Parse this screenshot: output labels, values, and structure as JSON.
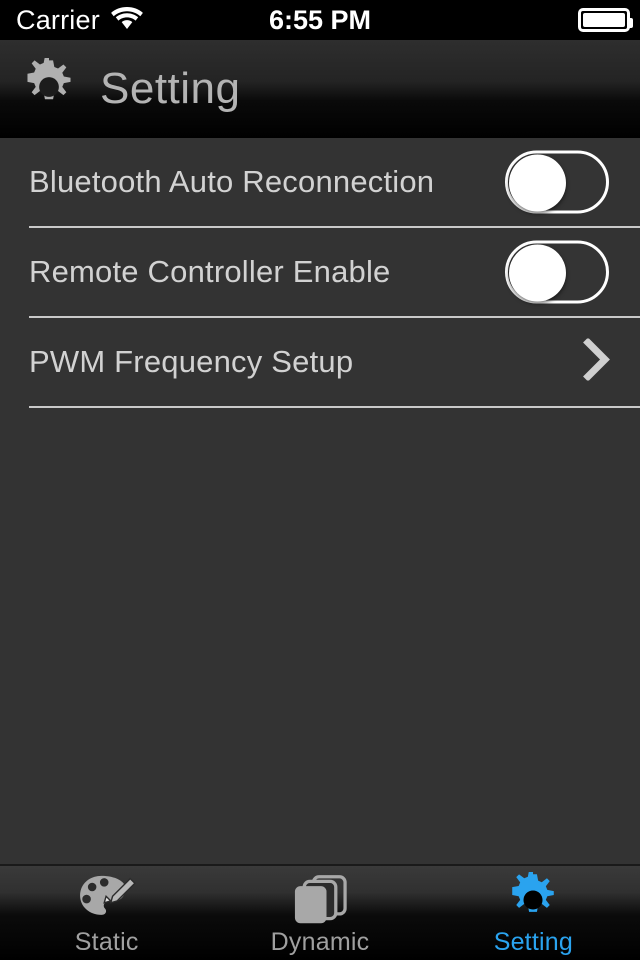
{
  "status_bar": {
    "carrier": "Carrier",
    "wifi_icon": "wifi-icon",
    "time": "6:55 PM",
    "battery_icon": "battery-full-icon"
  },
  "nav_bar": {
    "icon": "gear-icon",
    "title": "Setting"
  },
  "settings_rows": [
    {
      "label": "Bluetooth Auto Reconnection",
      "control": "toggle",
      "value": "off"
    },
    {
      "label": "Remote Controller Enable",
      "control": "toggle",
      "value": "off"
    },
    {
      "label": "PWM Frequency Setup",
      "control": "disclosure",
      "icon": "chevron-right-icon"
    }
  ],
  "tab_bar": {
    "items": [
      {
        "label": "Static",
        "icon": "palette-brush-icon",
        "active": false
      },
      {
        "label": "Dynamic",
        "icon": "stacked-cards-icon",
        "active": false
      },
      {
        "label": "Setting",
        "icon": "gear-icon",
        "active": true
      }
    ]
  },
  "colors": {
    "accent": "#2aa3ef",
    "content_bg": "#333333",
    "row_text": "#d2d2d2",
    "separator": "#c9c9c9",
    "nav_title": "#b4b4b4",
    "tab_inactive": "#a0a0a0"
  }
}
